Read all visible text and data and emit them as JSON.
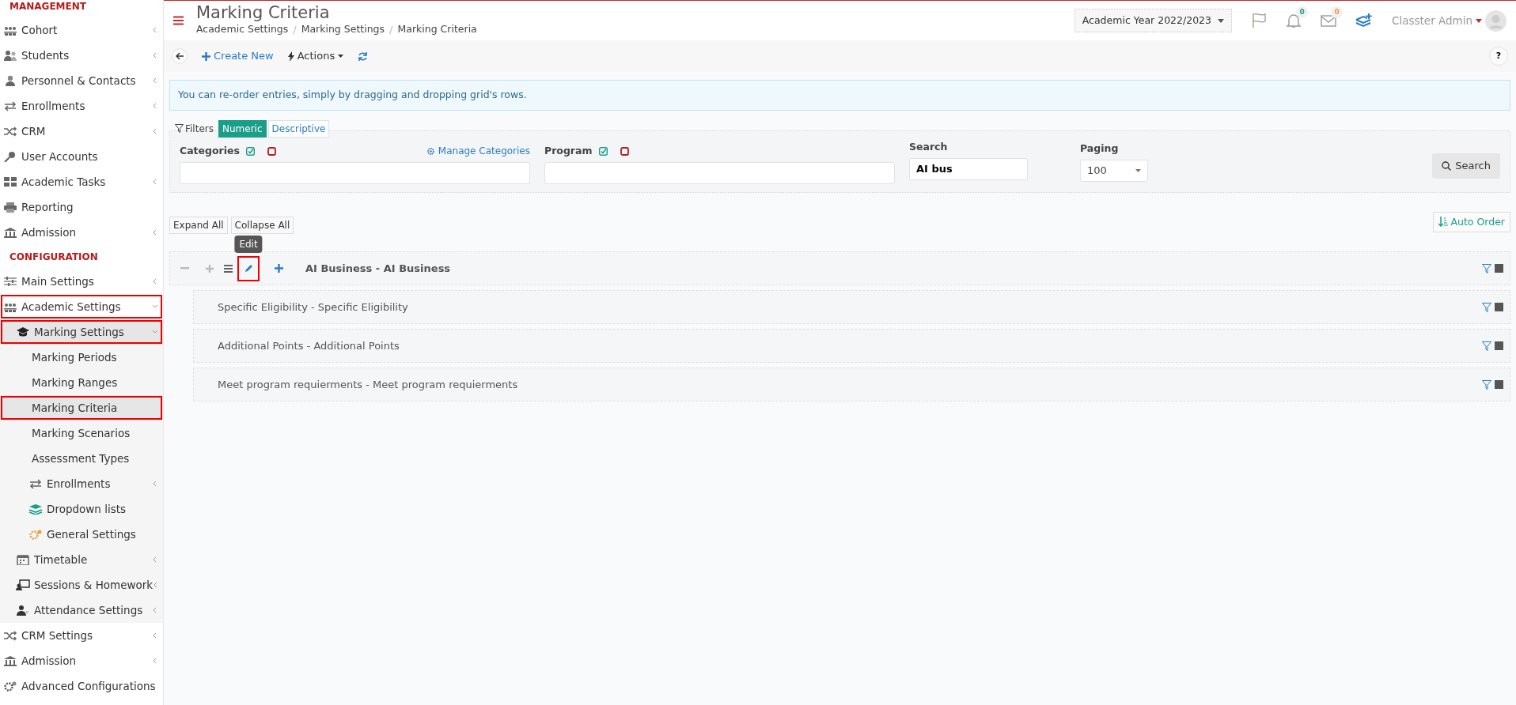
{
  "sidebar": {
    "sections": [
      {
        "heading": "MANAGEMENT",
        "items": [
          {
            "label": "Cohort",
            "expanded": false
          },
          {
            "label": "Students",
            "expanded": false
          },
          {
            "label": "Personnel & Contacts",
            "expanded": false
          },
          {
            "label": "Enrollments",
            "expanded": false
          },
          {
            "label": "CRM",
            "expanded": false
          },
          {
            "label": "User Accounts"
          },
          {
            "label": "Academic Tasks",
            "expanded": false
          },
          {
            "label": "Reporting"
          },
          {
            "label": "Admission",
            "expanded": false
          }
        ]
      },
      {
        "heading": "CONFIGURATION",
        "items": [
          {
            "label": "Main Settings",
            "expanded": false
          },
          {
            "label": "Academic Settings",
            "expanded": true,
            "selected": false,
            "highlighted": true,
            "children": [
              {
                "label": "Marking Settings",
                "expanded": true,
                "selected": true,
                "highlighted": true,
                "children": [
                  {
                    "label": "Marking Periods",
                    "selected": false,
                    "highlighted": false
                  },
                  {
                    "label": "Marking Ranges",
                    "selected": false,
                    "highlighted": false
                  },
                  {
                    "label": "Marking Criteria",
                    "selected": true,
                    "highlighted": true
                  },
                  {
                    "label": "Marking Scenarios",
                    "selected": false,
                    "highlighted": false
                  },
                  {
                    "label": "Assessment Types",
                    "selected": false,
                    "highlighted": false
                  },
                  {
                    "label": "Enrollments",
                    "expanded": false,
                    "selected": false,
                    "highlighted": false
                  },
                  {
                    "label": "Dropdown lists",
                    "selected": false,
                    "highlighted": false
                  },
                  {
                    "label": "General Settings",
                    "selected": false,
                    "highlighted": false
                  }
                ]
              },
              {
                "label": "Timetable",
                "expanded": false,
                "selected": false,
                "highlighted": false
              },
              {
                "label": "Sessions & Homework",
                "expanded": false,
                "selected": false,
                "highlighted": false
              },
              {
                "label": "Attendance Settings",
                "expanded": false,
                "selected": false,
                "highlighted": false
              }
            ]
          },
          {
            "label": "CRM Settings",
            "expanded": false
          },
          {
            "label": "Admission",
            "expanded": false
          },
          {
            "label": "Advanced Configurations"
          }
        ]
      }
    ]
  },
  "header": {
    "title": "Marking Criteria",
    "breadcrumbs": [
      "Academic Settings",
      "Marking Settings",
      "Marking Criteria"
    ],
    "breadcrumb_separators": [
      "/",
      "/"
    ],
    "academic_year": "Academic Year 2022/2023",
    "notifications_count": "0",
    "messages_count": "0",
    "user": "Classter Admin"
  },
  "toolbar": {
    "create": "Create New",
    "actions": "Actions",
    "help": "?"
  },
  "info": "You can re-order entries, simply by dragging and dropping grid's rows.",
  "filters": {
    "label": "Filters",
    "tabs": [
      {
        "label": "Numeric",
        "selected": true
      },
      {
        "label": "Descriptive",
        "selected": false
      }
    ],
    "categories": {
      "label": "Categories",
      "link": "Manage Categories"
    },
    "program": {
      "label": "Program"
    },
    "search": {
      "label": "Search",
      "value": "AI bus"
    },
    "paging": {
      "label": "Paging",
      "value": "100"
    },
    "search_button": "Search"
  },
  "tree_actions": {
    "expand": "Expand All",
    "collapse": "Collapse All",
    "auto_order": "Auto Order"
  },
  "tree": [
    {
      "label": "AI Business - AI Business",
      "edit_highlighted": true,
      "tooltip": "Edit",
      "children": [
        {
          "label": "Specific Eligibility - Specific Eligibility"
        },
        {
          "label": "Additional Points - Additional Points"
        },
        {
          "label": "Meet program requierments - Meet program requierments"
        }
      ]
    }
  ]
}
